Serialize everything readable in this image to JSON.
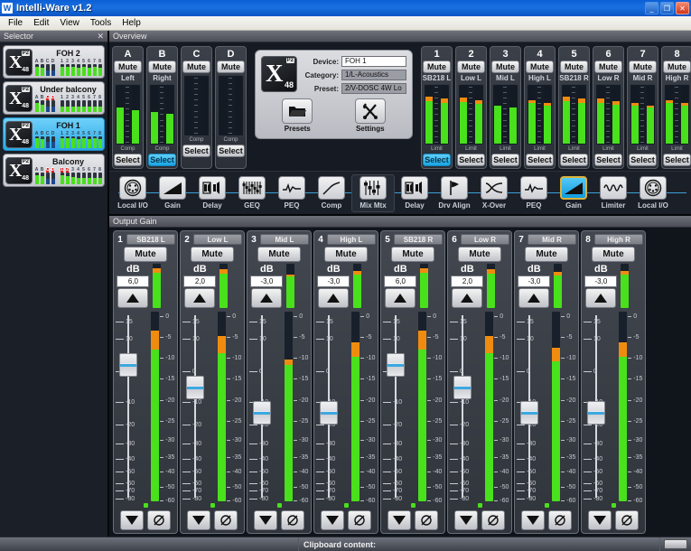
{
  "window": {
    "title": "Intelli-Ware v1.2",
    "icon": "W",
    "buttons": {
      "minimize": "_",
      "maximize": "❐",
      "close": "✕"
    }
  },
  "menubar": {
    "items": [
      "File",
      "Edit",
      "View",
      "Tools",
      "Help"
    ]
  },
  "selector": {
    "header": "Selector",
    "close": "✕",
    "items": [
      {
        "name": "FOH 2",
        "active": false,
        "abcd_labels": [
          "A",
          "B",
          "C",
          "D"
        ],
        "abcd_red": [
          false,
          false,
          false,
          false
        ],
        "abcd_levels": [
          70,
          65,
          45,
          45
        ],
        "num_labels": [
          "1",
          "2",
          "3",
          "4",
          "5",
          "6",
          "7",
          "8"
        ],
        "num_red": [
          false,
          false,
          false,
          false,
          false,
          false,
          false,
          false
        ],
        "num_levels": [
          75,
          70,
          72,
          68,
          70,
          66,
          70,
          64
        ]
      },
      {
        "name": "Under balcony",
        "active": false,
        "abcd_labels": [
          "A",
          "B",
          "C",
          "D"
        ],
        "abcd_red": [
          false,
          false,
          true,
          true
        ],
        "abcd_levels": [
          70,
          60,
          40,
          40
        ],
        "num_labels": [
          "1",
          "2",
          "3",
          "4",
          "5",
          "6",
          "7",
          "8"
        ],
        "num_red": [
          false,
          false,
          false,
          false,
          false,
          false,
          false,
          false
        ],
        "num_levels": [
          40,
          40,
          40,
          40,
          40,
          40,
          40,
          40
        ]
      },
      {
        "name": "FOH 1",
        "active": true,
        "abcd_labels": [
          "A",
          "B",
          "C",
          "D"
        ],
        "abcd_red": [
          false,
          false,
          false,
          false
        ],
        "abcd_levels": [
          78,
          72,
          50,
          50
        ],
        "num_labels": [
          "1",
          "2",
          "3",
          "4",
          "5",
          "6",
          "7",
          "8"
        ],
        "num_red": [
          false,
          false,
          false,
          false,
          false,
          false,
          false,
          false
        ],
        "num_levels": [
          80,
          78,
          80,
          75,
          78,
          72,
          78,
          70
        ]
      },
      {
        "name": "Balcony",
        "active": false,
        "abcd_labels": [
          "A",
          "B",
          "C",
          "D"
        ],
        "abcd_red": [
          false,
          false,
          true,
          true
        ],
        "abcd_levels": [
          70,
          65,
          45,
          45
        ],
        "num_labels": [
          "1",
          "2",
          "3",
          "4",
          "5",
          "6",
          "7",
          "8"
        ],
        "num_red": [
          true,
          true,
          false,
          false,
          false,
          false,
          false,
          false
        ],
        "num_levels": [
          70,
          65,
          55,
          50,
          50,
          50,
          50,
          50
        ]
      }
    ]
  },
  "overview": {
    "header": "Overview",
    "input_strips": [
      {
        "num": "A",
        "mute": "Mute",
        "label": "Left",
        "select": "Select",
        "select_active": false,
        "foot": "Comp",
        "level": 62,
        "orange": 0
      },
      {
        "num": "B",
        "mute": "Mute",
        "label": "Right",
        "select": "Select",
        "select_active": true,
        "foot": "Comp",
        "level": 55,
        "orange": 0
      },
      {
        "num": "C",
        "mute": "Mute",
        "label": "",
        "select": "Select",
        "select_active": false,
        "foot": "Comp",
        "level": 0,
        "orange": 0
      },
      {
        "num": "D",
        "mute": "Mute",
        "label": "",
        "select": "Select",
        "select_active": false,
        "foot": "Comp",
        "level": 0,
        "orange": 0
      }
    ],
    "device": {
      "fields": [
        {
          "label": "Device:",
          "value": "FOH 1",
          "editable": true
        },
        {
          "label": "Category:",
          "value": "1/L-Acoustics",
          "editable": false
        },
        {
          "label": "Preset:",
          "value": "2/V-DOSC 4W Lo",
          "editable": false
        }
      ],
      "buttons": [
        {
          "label": "Presets",
          "icon": "folder-icon"
        },
        {
          "label": "Settings",
          "icon": "tools-icon"
        }
      ]
    },
    "output_strips": [
      {
        "num": "1",
        "mute": "Mute",
        "label": "SB218 L",
        "select": "Select",
        "select_active": true,
        "foot": "Limit",
        "level": 74,
        "orange": 8
      },
      {
        "num": "2",
        "mute": "Mute",
        "label": "Low L",
        "select": "Select",
        "select_active": false,
        "foot": "Limit",
        "level": 72,
        "orange": 7
      },
      {
        "num": "3",
        "mute": "Mute",
        "label": "Mid L",
        "select": "Select",
        "select_active": false,
        "foot": "Limit",
        "level": 66,
        "orange": 0
      },
      {
        "num": "4",
        "mute": "Mute",
        "label": "High L",
        "select": "Select",
        "select_active": false,
        "foot": "Limit",
        "level": 70,
        "orange": 5
      },
      {
        "num": "5",
        "mute": "Mute",
        "label": "SB218 R",
        "select": "Select",
        "select_active": false,
        "foot": "Limit",
        "level": 74,
        "orange": 8
      },
      {
        "num": "6",
        "mute": "Mute",
        "label": "Low R",
        "select": "Select",
        "select_active": false,
        "foot": "Limit",
        "level": 71,
        "orange": 7
      },
      {
        "num": "7",
        "mute": "Mute",
        "label": "Mid R",
        "select": "Select",
        "select_active": false,
        "foot": "Limit",
        "level": 66,
        "orange": 4
      },
      {
        "num": "8",
        "mute": "Mute",
        "label": "High R",
        "select": "Select",
        "select_active": false,
        "foot": "Limit",
        "level": 70,
        "orange": 5
      }
    ]
  },
  "chain": {
    "input_section": [
      {
        "label": "Local I/O",
        "icon": "connector-icon",
        "selected": false
      },
      {
        "label": "Gain",
        "icon": "gain-ramp-icon",
        "selected": false
      },
      {
        "label": "Delay",
        "icon": "delay-icon",
        "selected": false
      },
      {
        "label": "GEQ",
        "icon": "geq-icon",
        "selected": false
      },
      {
        "label": "PEQ",
        "icon": "peq-curve-icon",
        "selected": false
      },
      {
        "label": "Comp",
        "icon": "comp-curve-icon",
        "selected": false
      }
    ],
    "matrix": {
      "label": "Mix Mtx",
      "icon": "mix-matrix-icon",
      "selected": false
    },
    "output_section": [
      {
        "label": "Delay",
        "icon": "delay-icon",
        "selected": false
      },
      {
        "label": "Drv Align",
        "icon": "drv-align-icon",
        "selected": false
      },
      {
        "label": "X-Over",
        "icon": "xover-icon",
        "selected": false
      },
      {
        "label": "PEQ",
        "icon": "peq-curve-icon",
        "selected": false
      },
      {
        "label": "Gain",
        "icon": "gain-ramp-icon",
        "selected": true
      },
      {
        "label": "Limiter",
        "icon": "limiter-icon",
        "selected": false
      },
      {
        "label": "Local I/O",
        "icon": "connector-icon",
        "selected": false
      }
    ]
  },
  "output_gain": {
    "header": "Output Gain",
    "db_label": "dB",
    "up_arrow": "▲",
    "down_arrow": "▼",
    "phase_symbol": "Ø",
    "fader_scale": [
      "15",
      "10",
      "0",
      "-10",
      "-20",
      "-30",
      "-40",
      "-50",
      "-60",
      "-70",
      "-80"
    ],
    "meter_scale": [
      "0",
      "-5",
      "-10",
      "-15",
      "-20",
      "-25",
      "-30",
      "-35",
      "-40",
      "-50",
      "-60"
    ],
    "channels": [
      {
        "num": "1",
        "name": "SB218 L",
        "mute": "Mute",
        "db": "6,0",
        "fader_pct": 22,
        "meter_green": 80,
        "meter_orange": 10,
        "has_phase": true,
        "led": true
      },
      {
        "num": "2",
        "name": "Low L",
        "mute": "Mute",
        "db": "2,0",
        "fader_pct": 34,
        "meter_green": 78,
        "meter_orange": 9,
        "has_phase": true,
        "led": true
      },
      {
        "num": "3",
        "name": "Mid L",
        "mute": "Mute",
        "db": "-3,0",
        "fader_pct": 47,
        "meter_green": 72,
        "meter_orange": 3,
        "has_phase": true,
        "led": true
      },
      {
        "num": "4",
        "name": "High L",
        "mute": "Mute",
        "db": "-3,0",
        "fader_pct": 47,
        "meter_green": 76,
        "meter_orange": 8,
        "has_phase": true,
        "led": true
      },
      {
        "num": "5",
        "name": "SB218 R",
        "mute": "Mute",
        "db": "6,0",
        "fader_pct": 22,
        "meter_green": 80,
        "meter_orange": 10,
        "has_phase": true,
        "led": true
      },
      {
        "num": "6",
        "name": "Low R",
        "mute": "Mute",
        "db": "2,0",
        "fader_pct": 34,
        "meter_green": 78,
        "meter_orange": 9,
        "has_phase": true,
        "led": true
      },
      {
        "num": "7",
        "name": "Mid R",
        "mute": "Mute",
        "db": "-3,0",
        "fader_pct": 47,
        "meter_green": 74,
        "meter_orange": 7,
        "has_phase": true,
        "led": true
      },
      {
        "num": "8",
        "name": "High R",
        "mute": "Mute",
        "db": "-3,0",
        "fader_pct": 47,
        "meter_green": 76,
        "meter_orange": 8,
        "has_phase": true,
        "led": true
      }
    ]
  },
  "statusbar": {
    "left": "",
    "clipboard": "Clipboard content:"
  },
  "colors": {
    "accent_blue": "#19a6e6",
    "meter_green": "#49e01c",
    "meter_orange": "#ef8c10",
    "alert_red": "#e02020",
    "panel_bg": "#161b23"
  }
}
